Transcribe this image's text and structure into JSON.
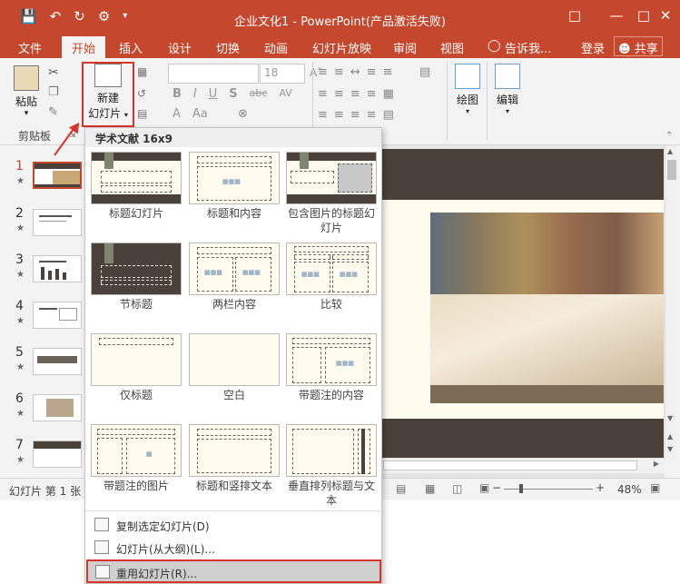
{
  "window": {
    "title": "企业文化1 - PowerPoint(产品激活失败)",
    "qat": [
      "save-icon",
      "undo-icon",
      "redo-icon",
      "present-icon",
      "customize-icon"
    ],
    "controls": [
      "ribbon-display-icon",
      "minimize-icon",
      "maximize-icon",
      "close-icon"
    ]
  },
  "tabs": {
    "file": "文件",
    "home": "开始",
    "insert": "插入",
    "design": "设计",
    "transitions": "切换",
    "animations": "动画",
    "slideshow": "幻灯片放映",
    "review": "审阅",
    "view": "视图",
    "tellme": "告诉我...",
    "login": "登录",
    "share": "共享"
  },
  "ribbon": {
    "paste": "粘贴",
    "clipboard": "剪贴板",
    "new_slide_line1": "新建",
    "new_slide_line2": "幻灯片",
    "font_size": "18",
    "drawing": "绘图",
    "editing": "编辑",
    "format_buttons": [
      "B",
      "I",
      "U",
      "S",
      "abc",
      "AV"
    ],
    "format_row2": [
      "A",
      "Aa"
    ]
  },
  "slides": [
    "1",
    "2",
    "3",
    "4",
    "5",
    "6",
    "7"
  ],
  "status": {
    "slide_info": "幻灯片 第 1 张",
    "zoom": "48%",
    "zoom_minus": "−",
    "zoom_plus": "+"
  },
  "dropdown": {
    "theme_header": "学术文献 16x9",
    "layouts": [
      "标题幻灯片",
      "标题和内容",
      "包含图片的标题幻灯片",
      "节标题",
      "两栏内容",
      "比较",
      "仅标题",
      "空白",
      "带题注的内容",
      "带题注的图片",
      "标题和竖排文本",
      "垂直排列标题与文本"
    ],
    "menu": {
      "duplicate": "复制选定幻灯片(D)",
      "from_outline": "幻灯片(从大纲)(L)...",
      "reuse": "重用幻灯片(R)..."
    }
  },
  "colors": {
    "accent": "#c5472d",
    "highlight_border": "#d9342b",
    "slide_band": "#4a413b",
    "slide_bg": "#fffbee"
  }
}
